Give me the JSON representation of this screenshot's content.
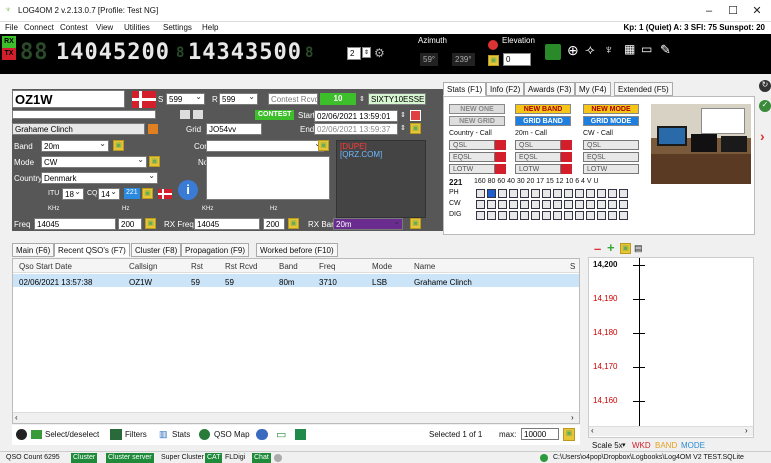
{
  "window": {
    "title": "LOG4OM 2 v.2.13.0.7 [Profile: Test NG]"
  },
  "menu": {
    "items": [
      "File",
      "Connect",
      "Contest",
      "View",
      "Utilities",
      "Settings",
      "Help"
    ],
    "status": "Kp: 1 (Quiet) A: 3 SFI: 75 Sunspot: 20"
  },
  "toolbar": {
    "rx": "RX",
    "tx": "TX",
    "freq_main": "14045200",
    "freq_sub": "14343500",
    "vfo": "2",
    "azimuth_label": "Azimuth",
    "azimuth_value": "59°",
    "azimuth_back": "239°",
    "elevation_label": "Elevation",
    "elevation_value": "0"
  },
  "callsign": {
    "value": "OZ1W",
    "rst_s": "599",
    "rst_r": "599",
    "contest_rcvd_label": "Contest Rcvd",
    "contest_num": "10",
    "exchange": "SIXTY10ESSE"
  },
  "contest": {
    "badge": "CONTEST",
    "start_label": "Start",
    "start": "02/06/2021 13:59:01",
    "end_label": "End",
    "end": "02/06/2021 13:59:37"
  },
  "station": {
    "name": "Grahame Clinch",
    "grid_label": "Grid",
    "grid": "JO54vv"
  },
  "form": {
    "band_label": "Band",
    "band": "20m",
    "mode_label": "Mode",
    "mode": "CW",
    "country_label": "Country",
    "country": "Denmark",
    "itu_label": "ITU",
    "itu": "18",
    "cq_label": "CQ",
    "cq": "14",
    "dxcc": "221",
    "comment_label": "Comment",
    "note_label": "Note",
    "dupe": "[DUPE]",
    "qrz": "[QRZ.COM]",
    "freq_label": "Freq",
    "freq": "14045",
    "freq_khz": "200",
    "rx_freq_label": "RX Freq",
    "rx_freq": "14045",
    "rx_khz": "200",
    "rx_band_label": "RX Band",
    "rx_band": "20m",
    "khz": "KHz",
    "hz": "Hz"
  },
  "stats_tabs": [
    "Stats (F1)",
    "Info (F2)",
    "Awards (F3)",
    "My (F4)",
    "Extended (F5)"
  ],
  "stats": {
    "new_one": "NEW ONE",
    "new_band": "NEW BAND",
    "new_mode": "NEW MODE",
    "new_grid": "NEW GRID",
    "grid_band": "GRID BAND",
    "grid_mode": "GRID MODE",
    "col1": "Country - Call",
    "col2": "20m - Call",
    "col3": "CW - Call",
    "qsl": "QSL",
    "eqsl": "EQSL",
    "lotw": "LOTW",
    "dxcc": "221",
    "bands": "160 80 60 40 30 20 17 15 12 10 6 4 V U",
    "rows": [
      "PH",
      "CW",
      "DIG"
    ]
  },
  "main_tabs": [
    "Main (F6)",
    "Recent QSO's (F7)",
    "Cluster (F8)",
    "Propagation (F9)",
    "Worked before (F10)"
  ],
  "table": {
    "headers": [
      "Qso Start Date",
      "Callsign",
      "Rst",
      "Rst Rcvd",
      "Band",
      "Freq",
      "Mode",
      "Name",
      "S"
    ],
    "rows": [
      [
        "02/06/2021 13:57:38",
        "OZ1W",
        "59",
        "59",
        "80m",
        "3710",
        "LSB",
        "Grahame Clinch"
      ]
    ]
  },
  "bottom": {
    "select": "Select/deselect",
    "filters": "Filters",
    "stats": "Stats",
    "qso_map": "QSO Map",
    "selected": "Selected 1 of 1",
    "max_label": "max:",
    "max": "10000"
  },
  "chart": {
    "ticks": [
      "14,200",
      "14,190",
      "14,180",
      "14,170",
      "14,160"
    ],
    "scale": "Scale 5x",
    "wkd": "WKD",
    "band": "BAND",
    "mode": "MODE"
  },
  "status": {
    "count": "QSO Count 6295",
    "cluster": "Cluster",
    "cluster_server": "Cluster server",
    "super": "Super Cluster",
    "cat": "CAT",
    "fldigi": "FLDigi",
    "chat": "Chat",
    "path": "C:\\Users\\o4pop\\Dropbox\\Logbooks\\Log4OM V2 TEST.SQLite"
  },
  "colors": {
    "accent_green": "#3cbf2a",
    "toolbar_bg": "#000000",
    "panel_bg": "#575757",
    "red_flag": "#d21f2b"
  }
}
